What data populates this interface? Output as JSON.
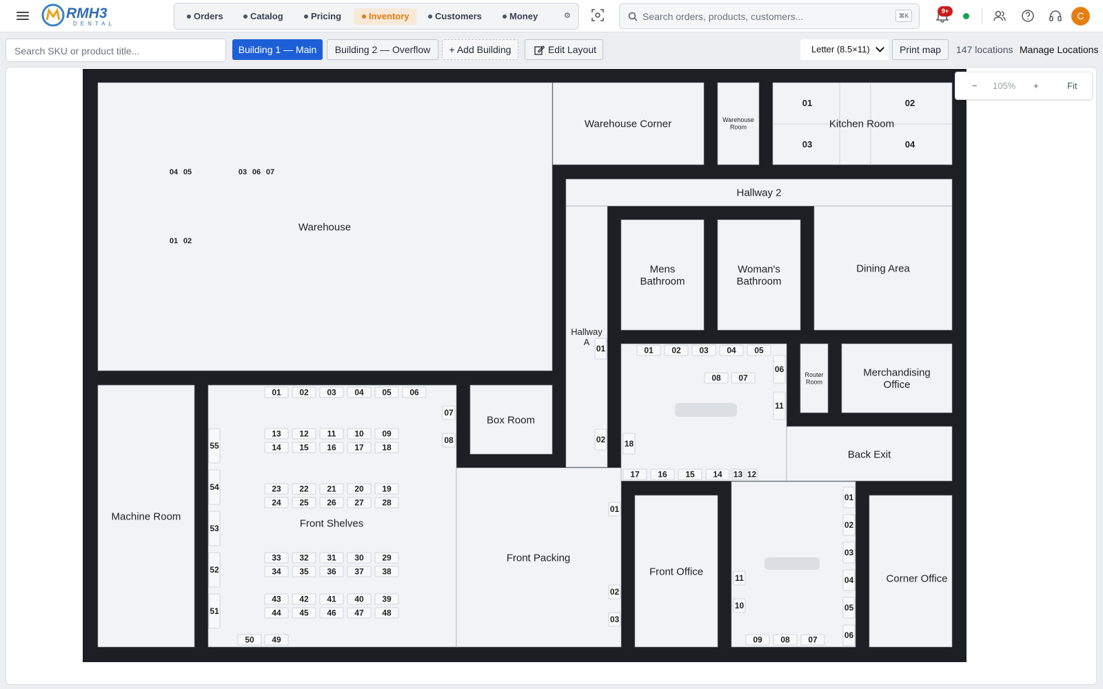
{
  "app": {
    "logo_text": "RMH3",
    "logo_sub": "DENTAL"
  },
  "nav": {
    "items": [
      "Orders",
      "Catalog",
      "Pricing",
      "Inventory",
      "Customers",
      "Money"
    ],
    "active": "Inventory",
    "accent": "#e07b12"
  },
  "search": {
    "placeholder": "Search orders, products, customers...",
    "shortcut": "⌘K"
  },
  "notifications": {
    "badge": "9+"
  },
  "user": {
    "initial": "C"
  },
  "toolbar": {
    "sku_placeholder": "Search SKU or product title...",
    "building_1": "Building 1 — Main",
    "building_2": "Building 2 — Overflow",
    "add_building": "+ Add Building",
    "edit_layout": "Edit Layout",
    "paper_size": "Letter (8.5×11)",
    "print_map": "Print map",
    "location_count": "147 locations",
    "manage_locations": "Manage Locations"
  },
  "zoom": {
    "minus": "−",
    "level": "105%",
    "plus": "+",
    "fit": "Fit"
  },
  "map": {
    "rooms": {
      "warehouse": "Warehouse",
      "warehouse_corner": "Warehouse Corner",
      "warehouse_room_1": "Warehouse",
      "warehouse_room_2": "Room",
      "kitchen": "Kitchen Room",
      "hallway_2": "Hallway 2",
      "hallway_a_1": "Hallway",
      "hallway_a_2": "A",
      "mens_1": "Mens",
      "mens_2": "Bathroom",
      "womans_1": "Woman's",
      "womans_2": "Bathroom",
      "dining": "Dining Area",
      "router_1": "Router",
      "router_2": "Room",
      "merch_1": "Merchandising",
      "merch_2": "Office",
      "back_exit": "Back Exit",
      "box_room": "Box Room",
      "machine_room": "Machine Room",
      "front_shelves": "Front Shelves",
      "front_packing": "Front Packing",
      "front_office": "Front Office",
      "corner_office": "Corner Office"
    }
  }
}
